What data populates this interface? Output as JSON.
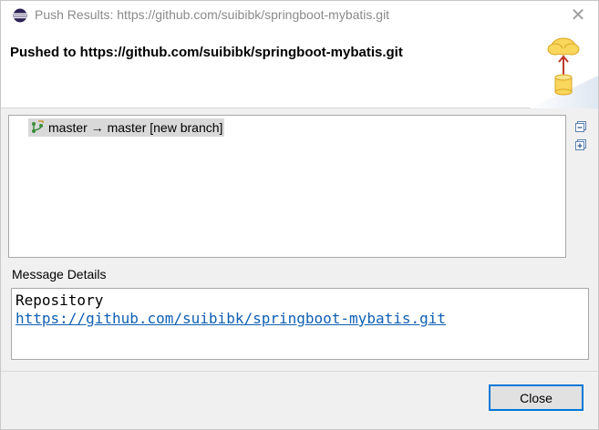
{
  "window": {
    "title": "Push Results: https://github.com/suibibk/springboot-mybatis.git"
  },
  "header": {
    "title": "Pushed to https://github.com/suibibk/springboot-mybatis.git",
    "banner_icon": "cloud-upload-database-icon"
  },
  "results": {
    "rows": [
      {
        "label": "master → master [new branch]",
        "icon": "branch-icon"
      }
    ],
    "collapse_icon": "collapse-all-icon",
    "expand_icon": "expand-all-icon"
  },
  "details": {
    "label": "Message Details",
    "line1": "Repository",
    "link": "https://github.com/suibibk/springboot-mybatis.git"
  },
  "footer": {
    "close_label": "Close"
  },
  "colors": {
    "link": "#0f5fb3",
    "selection": "#d9d9d9",
    "button_border": "#0078d7"
  }
}
